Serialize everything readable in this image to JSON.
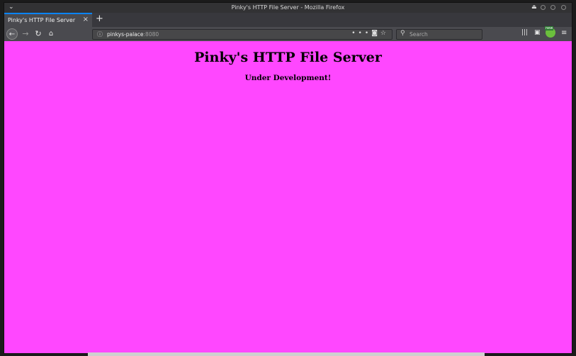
{
  "window": {
    "title": "Pinky's HTTP File Server - Mozilla Firefox"
  },
  "tabs": [
    {
      "label": "Pinky's HTTP File Server",
      "active": true
    }
  ],
  "navbar": {
    "url_host": "pinkys-palace",
    "url_port": ":8080",
    "search_placeholder": "Search"
  },
  "page": {
    "heading": "Pinky's HTTP File Server",
    "subheading": "Under Development!",
    "background_color": "#ff47ff"
  },
  "icons": {
    "back": "back-arrow-icon",
    "forward": "forward-arrow-icon",
    "reload": "reload-icon",
    "home": "home-icon",
    "info": "info-icon",
    "page_actions": "more-icon",
    "pocket": "pocket-icon",
    "bookmark": "star-icon",
    "search": "search-icon",
    "library": "library-icon",
    "sidebar": "sidebar-icon",
    "menu": "hamburger-menu-icon"
  }
}
